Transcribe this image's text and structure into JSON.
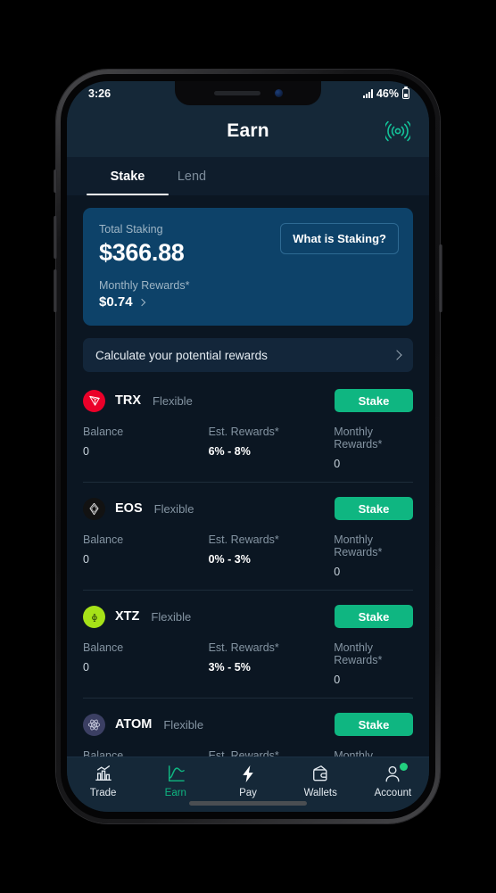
{
  "status_bar": {
    "time": "3:26",
    "battery_percent": "46%",
    "signal_icon": "cellular-signal-icon",
    "battery_icon": "battery-icon"
  },
  "header": {
    "title": "Earn",
    "broadcast_icon": "broadcast-signal-icon"
  },
  "tabs": [
    {
      "label": "Stake",
      "active": true
    },
    {
      "label": "Lend",
      "active": false
    }
  ],
  "staking_card": {
    "total_label": "Total Staking",
    "total_amount": "$366.88",
    "monthly_label": "Monthly Rewards*",
    "monthly_value": "$0.74",
    "what_is_staking_label": "What is Staking?",
    "chevron_icon": "chevron-right-icon",
    "card_color": "#0d4269"
  },
  "calculate_row": {
    "label": "Calculate your potential rewards",
    "chevron_icon": "chevron-right-icon"
  },
  "column_headers": {
    "balance": "Balance",
    "est_rewards": "Est. Rewards*",
    "monthly_rewards": "Monthly Rewards*"
  },
  "stake_button_label": "Stake",
  "accent_color": "#0fb681",
  "assets": [
    {
      "symbol": "TRX",
      "type": "Flexible",
      "icon": "tron-coin-icon",
      "icon_color": "#eb0029",
      "balance": "0",
      "est_rewards": "6% - 8%",
      "monthly_rewards": "0"
    },
    {
      "symbol": "EOS",
      "type": "Flexible",
      "icon": "eos-coin-icon",
      "icon_color": "#121212",
      "balance": "0",
      "est_rewards": "0% - 3%",
      "monthly_rewards": "0"
    },
    {
      "symbol": "XTZ",
      "type": "Flexible",
      "icon": "tezos-coin-icon",
      "icon_color": "#a6e218",
      "balance": "0",
      "est_rewards": "3% - 5%",
      "monthly_rewards": "0"
    },
    {
      "symbol": "ATOM",
      "type": "Flexible",
      "icon": "cosmos-coin-icon",
      "icon_color": "#3b3f63",
      "balance": "Balance",
      "est_rewards": "Est. Rewards*",
      "monthly_rewards": "Monthly Rewards*"
    }
  ],
  "bottom_nav": [
    {
      "label": "Trade",
      "icon": "bar-chart-icon",
      "active": false
    },
    {
      "label": "Earn",
      "icon": "line-chart-icon",
      "active": true
    },
    {
      "label": "Pay",
      "icon": "lightning-bolt-icon",
      "active": false
    },
    {
      "label": "Wallets",
      "icon": "wallet-icon",
      "active": false
    },
    {
      "label": "Account",
      "icon": "person-icon",
      "active": false
    }
  ]
}
